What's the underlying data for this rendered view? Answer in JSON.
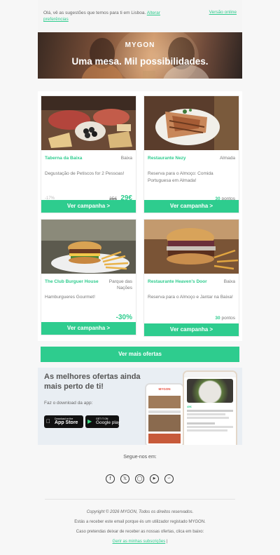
{
  "header": {
    "intro": "Olá, vê as sugestões que temos para ti em Lisboa.",
    "prefs_link": "Alterar preferências",
    "online_link": "Versão online"
  },
  "hero": {
    "logo": "MYGON",
    "title": "Uma mesa. Mil possibilidades."
  },
  "offers": [
    {
      "name": "Taberna da Baixa",
      "location": "Baixa",
      "description": "Degustação de Petiscos for 2 Pessoas!",
      "discount": "-17%",
      "old_price": "35€",
      "price": "29€",
      "button": "Ver campanha >"
    },
    {
      "name": "Restaurante Nezy",
      "location": "Almada",
      "description": "Reserva para o Almoço: Comida Portuguesa em Almada!",
      "points_value": "30",
      "points_label": "pontos",
      "button": "Ver campanha >"
    },
    {
      "name": "The Club Burguer House",
      "location": "Parque das Nações",
      "description": "Hamburgueres Gourmet!",
      "discount_big": "-30%",
      "button": "Ver campanha >"
    },
    {
      "name": "Restaurante Heaven's Door",
      "location": "Baixa",
      "description": "Reserva para o Almoço e Jantar na Baixa!",
      "points_value": "30",
      "points_label": "pontos",
      "button": "Ver campanha >"
    }
  ],
  "more_button": "Ver mais ofertas",
  "promo": {
    "title": "As melhores ofertas ainda mais perto de ti!",
    "download": "Faz o download da app:",
    "appstore_small": "Download on the",
    "appstore_big": "App Store",
    "gplay_small": "GET IT ON",
    "gplay_big": "Google play",
    "phone_logo": "MYGON",
    "phone_price": "45€"
  },
  "footer": {
    "follow": "Segue-nos em:",
    "socials": [
      "facebook-icon",
      "x-icon",
      "instagram-icon",
      "youtube-icon",
      "rss-icon"
    ],
    "copyright": "Copyright © 2026 MYGON, Todos os direitos reservados.",
    "line2": "Estás a receber este email porque és um utilizador registado MYGON.",
    "line3": "Caso pretendas deixar de receber as nossas ofertas, clica em baixo:",
    "manage_link": "Gerir as minhas subscrições",
    "sep": "|"
  },
  "colors": {
    "accent": "#2ecc8e",
    "bg": "#f7f7f7"
  }
}
